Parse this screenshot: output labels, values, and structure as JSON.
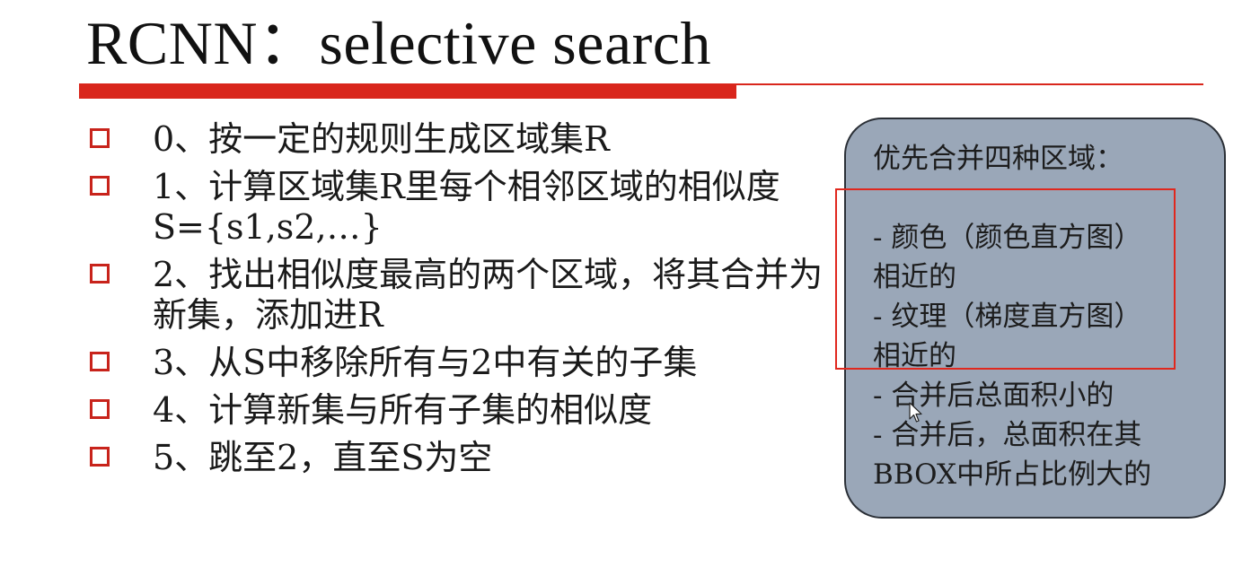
{
  "slide": {
    "title": "RCNN：selective search"
  },
  "steps": [
    "0、按一定的规则生成区域集R",
    "1、计算区域集R里每个相邻区域的相似度S={s1,s2,…}",
    "2、找出相似度最高的两个区域，将其合并为新集，添加进R",
    "3、从S中移除所有与2中有关的子集",
    "4、计算新集与所有子集的相似度",
    "5、跳至2，直至S为空"
  ],
  "callout": {
    "heading": "优先合并四种区域：",
    "lines": [
      "- 颜色（颜色直方图）",
      "相近的",
      "- 纹理（梯度直方图）",
      "相近的",
      "- 合并后总面积小的",
      "- 合并后，总面积在其",
      "BBOX中所占比例大的"
    ]
  },
  "colors": {
    "accent_red": "#d9261c",
    "bullet_red": "#c8231b",
    "callout_fill": "#9aa7b8",
    "highlight_border": "#e0281e"
  },
  "icons": {
    "bullet": "square-outline-icon",
    "cursor": "mouse-pointer-icon"
  }
}
